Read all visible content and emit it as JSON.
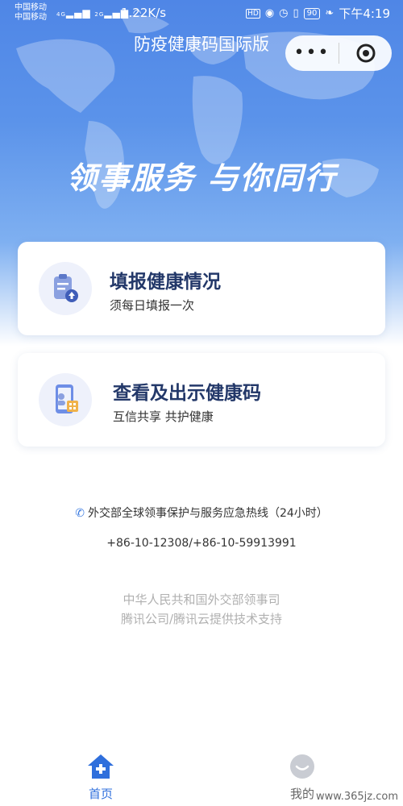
{
  "status_bar": {
    "carrier_1": "中国移动",
    "carrier_2": "中国移动",
    "net_1": "4G",
    "net_2": "2G",
    "speed": "1.22K/s",
    "hd": "HD",
    "battery": "90",
    "time": "下午4:19"
  },
  "header": {
    "title": "防疫健康码国际版",
    "more_icon": "more-dots-icon",
    "close_icon": "target-circle-icon"
  },
  "hero": {
    "slogan": "领事服务 与你同行"
  },
  "cards": [
    {
      "title": "填报健康情况",
      "subtitle": "须每日填报一次",
      "icon": "clipboard-upload-icon"
    },
    {
      "title": "查看及出示健康码",
      "subtitle": "互信共享 共护健康",
      "icon": "phone-qrcode-icon"
    }
  ],
  "hotline": {
    "label": "外交部全球领事保护与服务应急热线（24小时）",
    "numbers": "+86-10-12308/+86-10-59913991",
    "icon": "phone-icon"
  },
  "footer": {
    "line1": "中华人民共和国外交部领事司",
    "line2": "腾讯公司/腾讯云提供技术支持"
  },
  "tabbar": {
    "home_label": "首页",
    "me_label": "我的",
    "active": "home",
    "accent": "#2f6fdc"
  },
  "watermark": "www.365jz.com",
  "colors": {
    "primary": "#4f86e6",
    "card_title": "#233869",
    "muted": "#b0b0b0"
  }
}
